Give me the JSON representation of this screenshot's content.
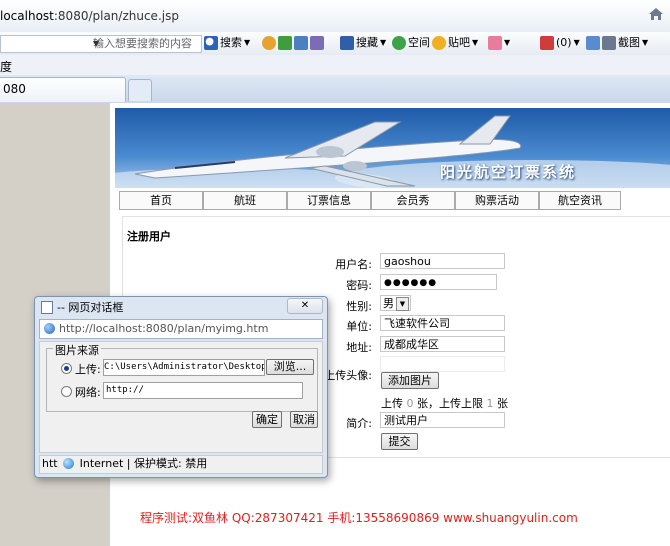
{
  "browser": {
    "url_host": "localhost",
    "url_rest": ":8080/plan/zhuce.jsp",
    "tab_title": "080",
    "menu_fragment": "度"
  },
  "toolbar": {
    "search_placeholder": "输入想要搜索的内容",
    "search_button": "搜索",
    "collect": "搜藏",
    "space": "空间",
    "tieba": "贴吧",
    "mail_count": "(0)",
    "screenshot": "截图"
  },
  "site": {
    "banner_title": "阳光航空订票系统",
    "nav": [
      "首页",
      "航班",
      "订票信息",
      "会员秀",
      "购票活动",
      "航空资讯"
    ]
  },
  "form": {
    "title": "注册用户",
    "username_label": "用户名:",
    "username_value": "gaoshou",
    "password_label": "密码:",
    "password_value": "●●●●●●",
    "gender_label": "性别:",
    "gender_value": "男",
    "company_label": "单位:",
    "company_value": "飞速软件公司",
    "address_label": "地址:",
    "address_value": "成都成华区",
    "avatar_label": "上传头像:",
    "add_image_button": "添加图片",
    "upload_prefix": "上传",
    "upload_count": "0",
    "upload_mid": "张，上传上限",
    "upload_limit": "1",
    "upload_suffix": "张",
    "intro_label": "简介:",
    "intro_value": "测试用户",
    "submit_button": "提交"
  },
  "footer": {
    "credit": "程序测试:双鱼林 QQ:287307421 手机:13558690869 www.shuangyulin.com"
  },
  "dialog": {
    "title": "-- 网页对话框",
    "url": "http://localhost:8080/plan/myimg.htm",
    "group_title": "图片来源",
    "upload_label": "上传:",
    "upload_path": "C:\\Users\\Administrator\\Desktop\\Q",
    "browse_button": "浏览...",
    "network_label": "网络:",
    "network_value": "http://",
    "ok_button": "确定",
    "cancel_button": "取消",
    "status_prefix": "htt",
    "status_zone": "Internet | 保护模式: 禁用"
  },
  "colors": {
    "footer_red": "#e02020",
    "sky_blue": "#3d7bc4"
  }
}
